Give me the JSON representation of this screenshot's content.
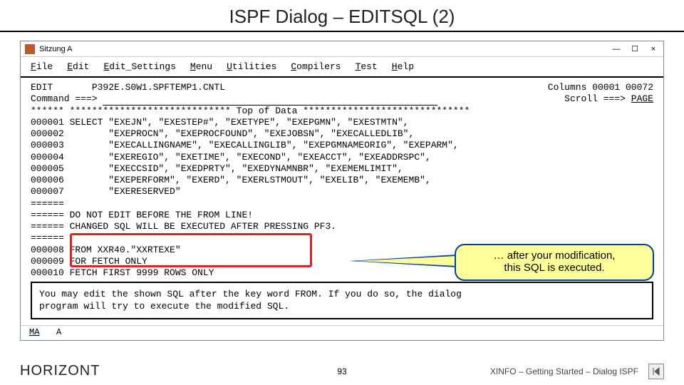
{
  "slide": {
    "title": "ISPF Dialog – EDITSQL (2)",
    "page_number": "93",
    "brand": "HORIZONT",
    "breadcrumb": "XINFO – Getting Started – Dialog ISPF"
  },
  "window": {
    "session_label": "Sitzung A",
    "sys": {
      "min": "—",
      "max": "☐",
      "close": "×"
    },
    "menu": [
      "File",
      "Edit",
      "Edit_Settings",
      "Menu",
      "Utilities",
      "Compilers",
      "Test",
      "Help"
    ],
    "edit_label": "EDIT",
    "dataset": "P392E.S0W1.SPFTEMP1.CNTL",
    "columns_label": "Columns 00001 00072",
    "command_label": "Command ===>",
    "scroll_label": "Scroll ===>",
    "scroll_value": "PAGE",
    "lines": [
      "****** ***************************** Top of Data ******************************",
      "000001 SELECT \"EXEJN\", \"EXESTEP#\", \"EXETYPE\", \"EXEPGMN\", \"EXESTMTN\",",
      "000002        \"EXEPROCN\", \"EXEPROCFOUND\", \"EXEJOBSN\", \"EXECALLEDLIB\",",
      "000003        \"EXECALLINGNAME\", \"EXECALLINGLIB\", \"EXEPGMNAMEORIG\", \"EXEPARM\",",
      "000004        \"EXEREGIO\", \"EXETIME\", \"EXECOND\", \"EXEACCT\", \"EXEADDRSPC\",",
      "000005        \"EXECCSID\", \"EXEDPRTY\", \"EXEDYNAMNBR\", \"EXEMEMLIMIT\",",
      "000006        \"EXEPERFORM\", \"EXERD\", \"EXERLSTMOUT\", \"EXELIB\", \"EXEMEMB\",",
      "000007        \"EXERESERVED\"",
      "======",
      "====== DO NOT EDIT BEFORE THE FROM LINE!",
      "====== CHANGED SQL WILL BE EXECUTED AFTER PRESSING PF3.",
      "======",
      "000008 FROM XXR40.\"XXRTEXE\"",
      "000009 FOR FETCH ONLY",
      "000010 FETCH FIRST 9999 ROWS ONLY"
    ],
    "help_box": "You may edit the shown SQL after the key word FROM. If you do so, the dialog\nprogram will try to execute the modified SQL.",
    "status_ma": "MA",
    "status_a": "A"
  },
  "callout": {
    "line1": "… after your modification,",
    "line2": "this SQL is executed."
  }
}
